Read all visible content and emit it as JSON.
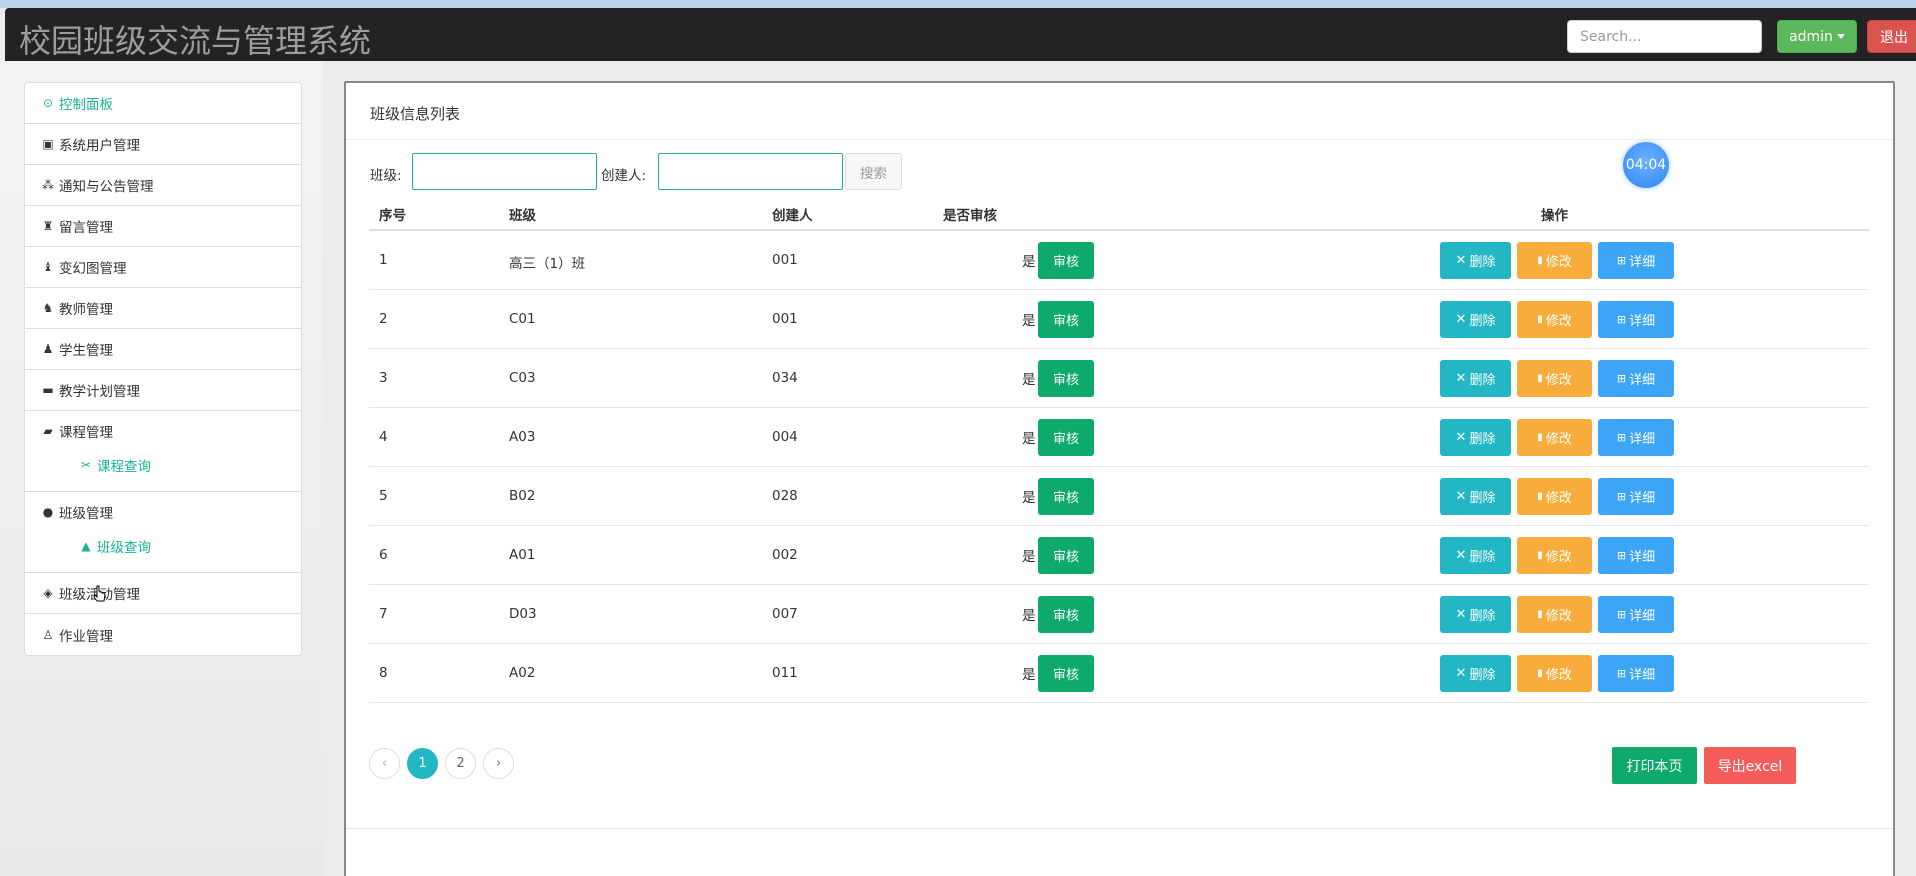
{
  "app": {
    "title": "校园班级交流与管理系统",
    "search_placeholder": "Search...",
    "user_label": "admin",
    "logout_label": "退出"
  },
  "sidebar": {
    "items": [
      {
        "label": "控制面板",
        "icon": "dashboard-icon"
      },
      {
        "label": "系统用户管理",
        "icon": "image-icon"
      },
      {
        "label": "通知与公告管理",
        "icon": "sitemap-icon"
      },
      {
        "label": "留言管理",
        "icon": "chess-icon"
      },
      {
        "label": "变幻图管理",
        "icon": "chess-icon"
      },
      {
        "label": "教师管理",
        "icon": "chess-knight-icon"
      },
      {
        "label": "学生管理",
        "icon": "chess-icon"
      },
      {
        "label": "教学计划管理",
        "icon": "monitor-icon"
      },
      {
        "label": "课程管理",
        "icon": "bus-icon",
        "sub": "课程查询"
      },
      {
        "label": "班级管理",
        "icon": "apple-icon",
        "sub": "班级查询"
      },
      {
        "label": "班级活动管理",
        "icon": "eraser-icon"
      },
      {
        "label": "作业管理",
        "icon": "lamp-icon"
      }
    ]
  },
  "main": {
    "panel_title": "班级信息列表",
    "filter_class_label": "班级:",
    "filter_creator_label": "创建人:",
    "search_button": "搜索",
    "timer": "04:04",
    "columns": [
      "序号",
      "班级",
      "创建人",
      "是否审核",
      "操作"
    ],
    "rows": [
      {
        "no": "1",
        "cls": "高三（1）班",
        "creator": "001",
        "audited": "是"
      },
      {
        "no": "2",
        "cls": "C01",
        "creator": "001",
        "audited": "是"
      },
      {
        "no": "3",
        "cls": "C03",
        "creator": "034",
        "audited": "是"
      },
      {
        "no": "4",
        "cls": "A03",
        "creator": "004",
        "audited": "是"
      },
      {
        "no": "5",
        "cls": "B02",
        "creator": "028",
        "audited": "是"
      },
      {
        "no": "6",
        "cls": "A01",
        "creator": "002",
        "audited": "是"
      },
      {
        "no": "7",
        "cls": "D03",
        "creator": "007",
        "audited": "是"
      },
      {
        "no": "8",
        "cls": "A02",
        "creator": "011",
        "audited": "是"
      }
    ],
    "audit_label": "审核",
    "delete_label": "删除",
    "edit_label": "修改",
    "detail_label": "详细",
    "pager": {
      "prev": "‹",
      "pages": [
        "1",
        "2"
      ],
      "next": "›",
      "current": "1"
    },
    "print_label": "打印本页",
    "export_label": "导出excel"
  },
  "colors": {
    "accent": "#1ab394",
    "audit": "#0eaa6b",
    "delete": "#23b7c5",
    "edit": "#f8ac3b",
    "detail": "#3ca5f6",
    "export": "#f45b5b"
  }
}
